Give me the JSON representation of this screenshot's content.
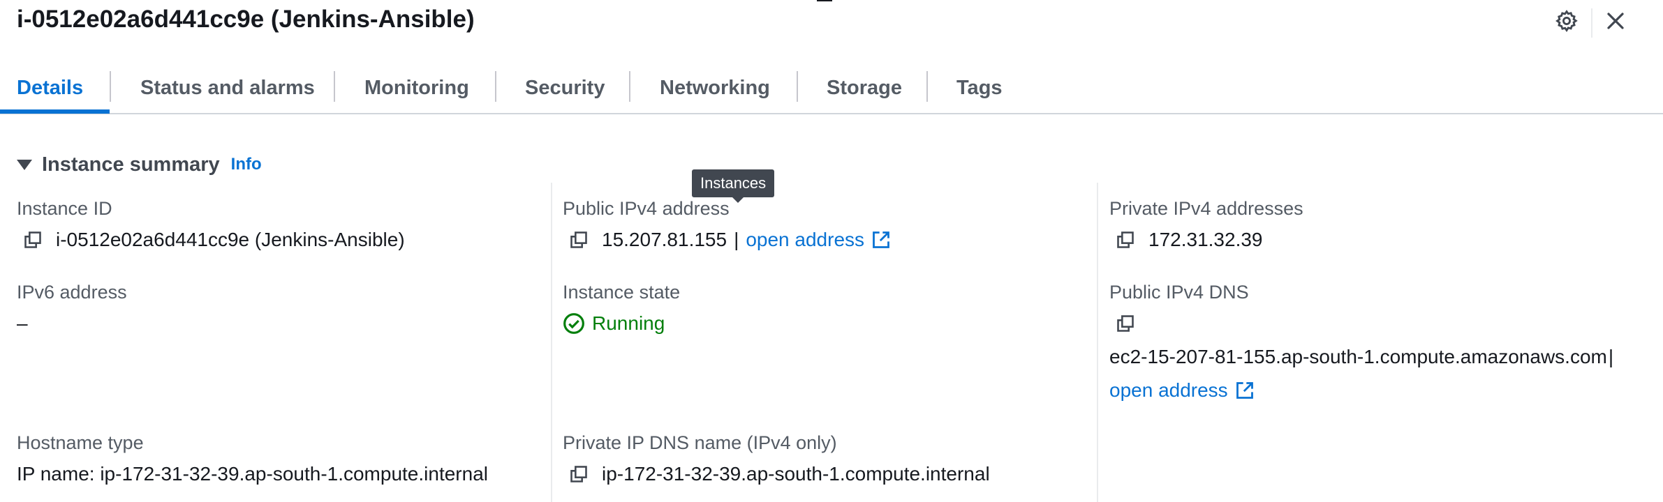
{
  "header": {
    "title": "i-0512e02a6d441cc9e (Jenkins-Ansible)",
    "settings_icon": "gear-icon",
    "close_icon": "close-icon"
  },
  "tabs": [
    {
      "label": "Details",
      "active": true
    },
    {
      "label": "Status and alarms",
      "active": false
    },
    {
      "label": "Monitoring",
      "active": false
    },
    {
      "label": "Security",
      "active": false
    },
    {
      "label": "Networking",
      "active": false
    },
    {
      "label": "Storage",
      "active": false
    },
    {
      "label": "Tags",
      "active": false
    }
  ],
  "summary": {
    "title": "Instance summary",
    "info": "Info",
    "instance_id": {
      "label": "Instance ID",
      "value": "i-0512e02a6d441cc9e (Jenkins-Ansible)"
    },
    "public_ipv4": {
      "label": "Public IPv4 address",
      "value": "15.207.81.155",
      "separator": "|",
      "link": "open address"
    },
    "private_ipv4": {
      "label": "Private IPv4 addresses",
      "value": "172.31.32.39"
    },
    "ipv6": {
      "label": "IPv6 address",
      "value": "–"
    },
    "instance_state": {
      "label": "Instance state",
      "value": "Running",
      "color": "#037f0c"
    },
    "public_dns": {
      "label": "Public IPv4 DNS",
      "value": "ec2-15-207-81-155.ap-south-1.compute.amazonaws.com",
      "separator": "|",
      "link": "open address"
    },
    "hostname_type": {
      "label": "Hostname type",
      "value": "IP name: ip-172-31-32-39.ap-south-1.compute.internal"
    },
    "private_dns": {
      "label": "Private IP DNS name (IPv4 only)",
      "value": "ip-172-31-32-39.ap-south-1.compute.internal"
    }
  },
  "tooltip": {
    "text": "Instances"
  },
  "colors": {
    "accent": "#0972d3",
    "success": "#037f0c",
    "text": "#16191f",
    "muted": "#545b64"
  }
}
